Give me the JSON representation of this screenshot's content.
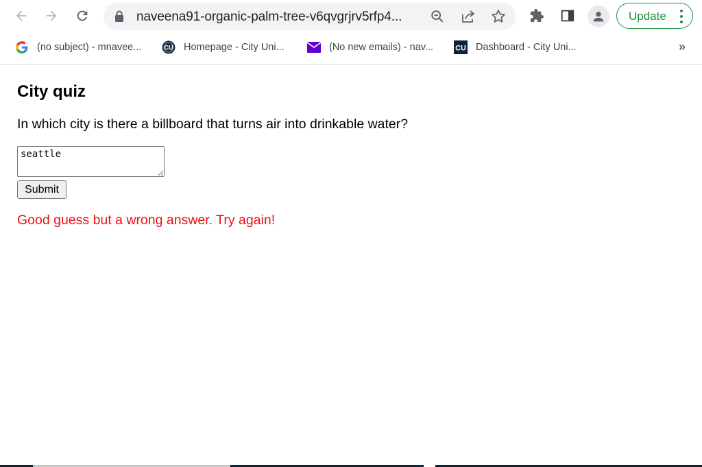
{
  "browser": {
    "url": "naveena91-organic-palm-tree-v6qvgrjrv5rfp4...",
    "update_label": "Update",
    "bookmarks": [
      {
        "label": "(no subject) - mnavee...",
        "icon": "google-icon"
      },
      {
        "label": "Homepage - City Uni...",
        "icon": "cu-round-icon"
      },
      {
        "label": "(No new emails) - nav...",
        "icon": "mail-icon"
      },
      {
        "label": "Dashboard - City Uni...",
        "icon": "cu-square-icon"
      }
    ],
    "more_label": "»"
  },
  "quiz": {
    "title": "City quiz",
    "question": "In which city is there a billboard that turns air into drinkable water?",
    "answer_value": "seattle",
    "submit_label": "Submit",
    "feedback": "Good guess but a wrong answer. Try again!"
  },
  "colors": {
    "feedback": "#e81313",
    "update_accent": "#1e8e3e"
  }
}
